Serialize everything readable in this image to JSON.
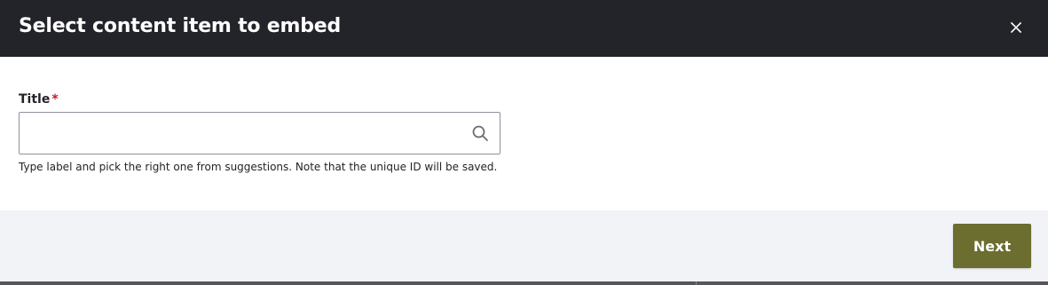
{
  "dialog": {
    "title": "Select content item to embed",
    "close_icon": "close-icon"
  },
  "form": {
    "title_field": {
      "label": "Title",
      "required_mark": "*",
      "value": "",
      "placeholder": "",
      "icon": "search-icon",
      "help_text": "Type label and pick the right one from suggestions. Note that the unique ID will be saved."
    }
  },
  "footer": {
    "next_label": "Next"
  },
  "colors": {
    "titlebar": "#232429",
    "footer_bg": "#f2f3f7",
    "primary_button": "#6b6e2f",
    "required": "#c01c28"
  }
}
